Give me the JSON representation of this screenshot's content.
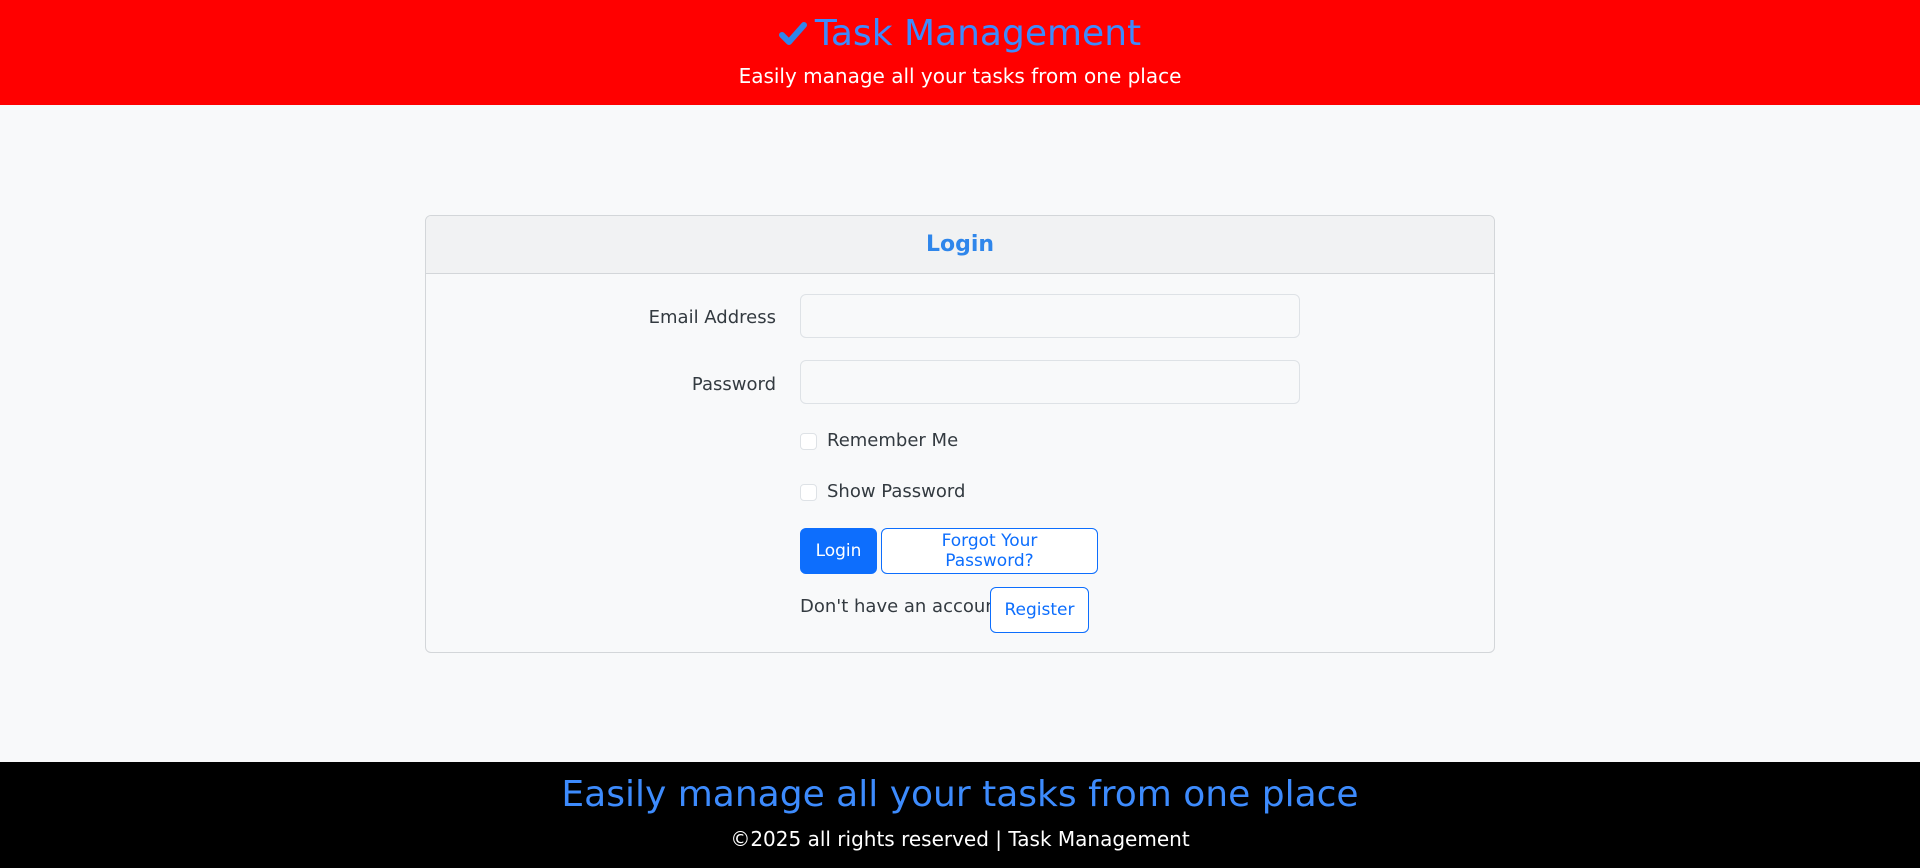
{
  "header": {
    "brand_icon": "check-mark-icon",
    "title": "Task Management",
    "tagline": "Easily manage all your tasks from one place"
  },
  "login_form": {
    "heading": "Login",
    "email_label": "Email Address",
    "email_value": "",
    "password_label": "Password",
    "password_value": "",
    "remember_label": "Remember Me",
    "show_password_label": "Show Password",
    "login_button": "Login",
    "forgot_button": "Forgot Your Password?",
    "no_account_text": "Don't have an account?",
    "register_button": "Register"
  },
  "footer": {
    "tagline": "Easily manage all your tasks from one place",
    "copyright": "©2025 all rights reserved | Task Management"
  },
  "colors": {
    "header_background": "#ff0000",
    "footer_background": "#000000",
    "brand_blue": "#3d8bfd",
    "primary_button": "#0d6efd"
  }
}
